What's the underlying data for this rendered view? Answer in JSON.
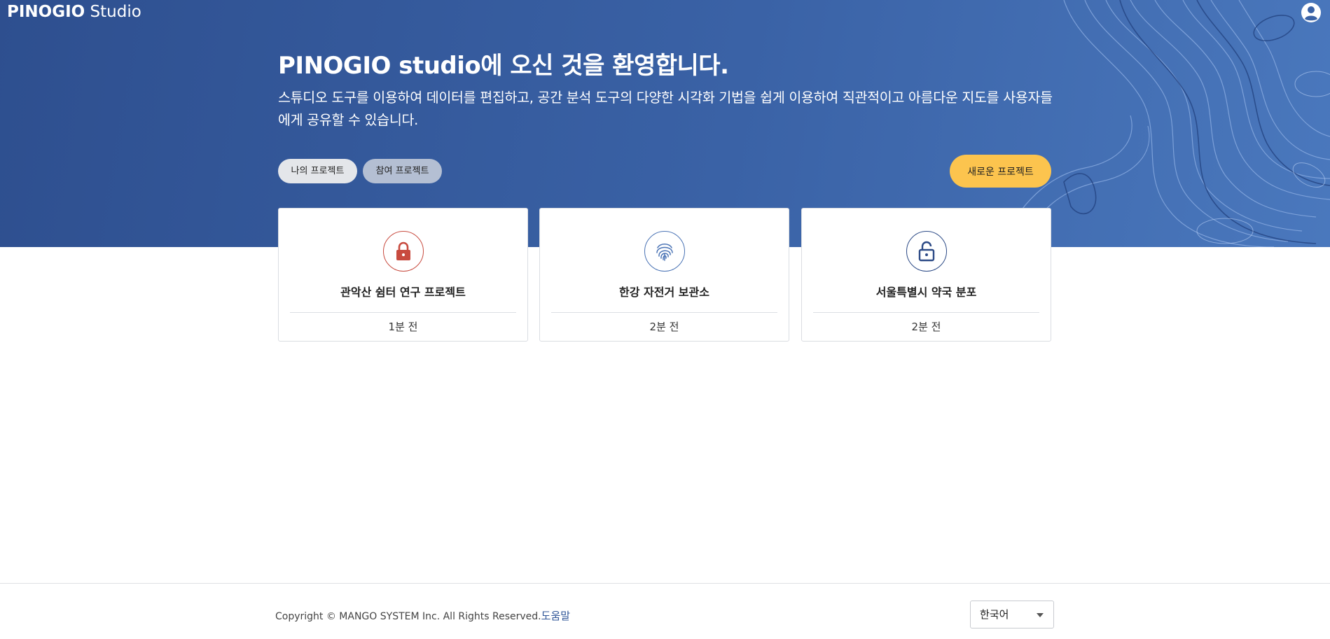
{
  "header": {
    "brand_bold": "PINOGIO",
    "brand_rest": "Studio",
    "user_icon": "user-circle-icon"
  },
  "hero": {
    "title": "PINOGIO studio에 오신 것을 환영합니다.",
    "description": "스튜디오 도구를 이용하여 데이터를 편집하고, 공간 분석 도구의 다양한 시각화 기법을 쉽게 이용하여 직관적이고 아름다운 지도를 사용자들에게 공유할 수 있습니다.",
    "tabs": [
      {
        "label": "나의 프로젝트",
        "active": true
      },
      {
        "label": "참여 프로젝트",
        "active": false
      }
    ],
    "new_project_label": "새로운 프로젝트"
  },
  "projects": [
    {
      "title": "관악산 쉼터 연구 프로젝트",
      "time": "1분 전",
      "icon": "lock-closed-icon",
      "color": "#c84b3f"
    },
    {
      "title": "한강 자전거 보관소",
      "time": "2분 전",
      "icon": "fingerprint-icon",
      "color": "#4a73b5"
    },
    {
      "title": "서울특별시 약국 분포",
      "time": "2분 전",
      "icon": "lock-open-icon",
      "color": "#2c4a86"
    }
  ],
  "footer": {
    "copyright": "Copyright © MANGO SYSTEM Inc. All Rights Reserved.",
    "help_label": "도움말",
    "language": "한국어"
  }
}
